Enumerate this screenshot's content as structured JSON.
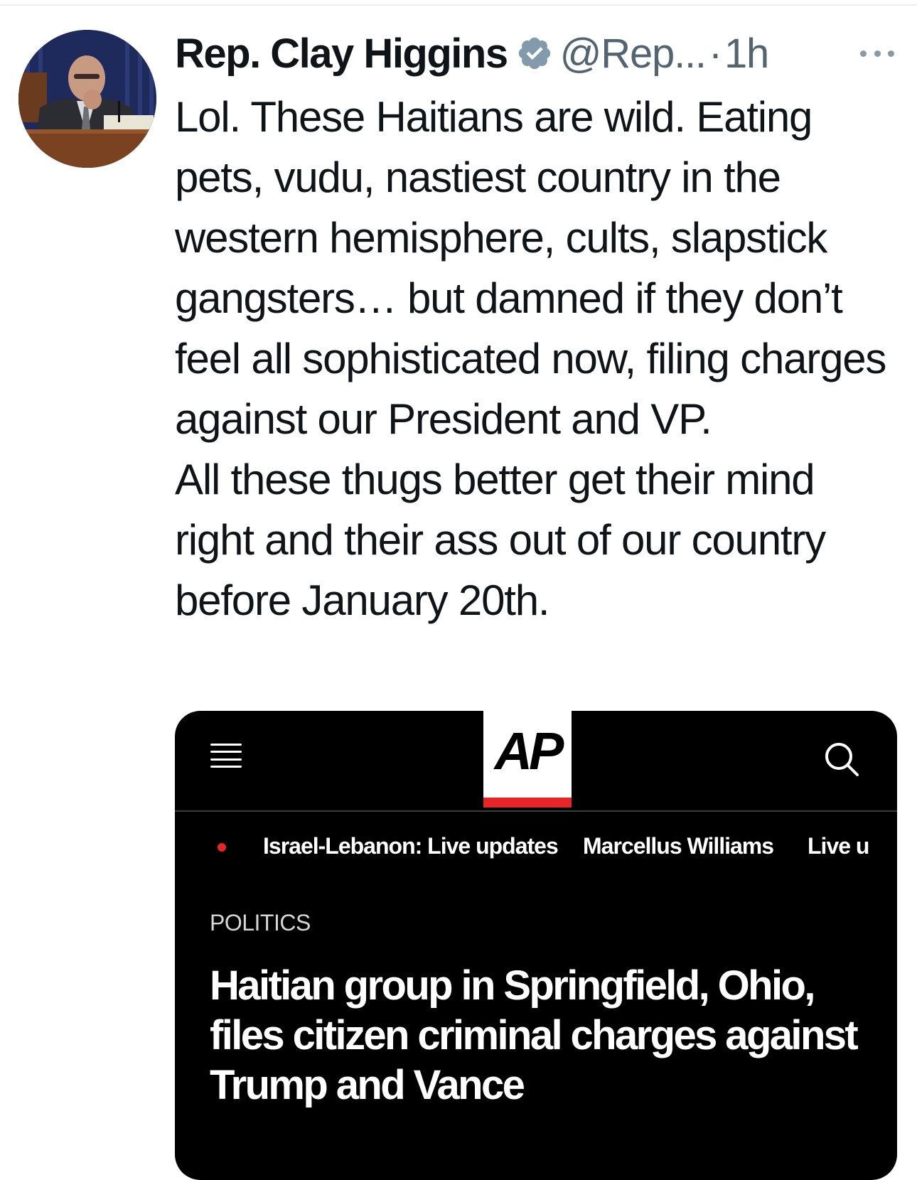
{
  "tweet": {
    "author": {
      "display_name": "Rep. Clay Higgins",
      "handle": "@Rep...",
      "verified": true,
      "avatar_icon": "profile-photo"
    },
    "separator": "·",
    "timestamp": "1h",
    "more_icon": "ellipsis-icon",
    "text": "Lol. These Haitians are wild. Eating pets, vudu, nastiest country in the western hemisphere, cults, slapstick gangsters… but damned if they don’t feel all sophisticated now, filing charges against our President and VP.\n  All these thugs better get their mind right and their ass out of our country before January 20th."
  },
  "card": {
    "menu_icon": "hamburger-menu-icon",
    "logo": "AP",
    "search_icon": "search-icon",
    "ticker": [
      "Israel-Lebanon: Live updates",
      "Marcellus Williams",
      "Live u"
    ],
    "section": "POLITICS",
    "headline": "Haitian group in Springfield, Ohio, files citizen criminal charges against Trump and Vance"
  },
  "colors": {
    "verified_badge": "#829aab",
    "secondary_text": "#536471",
    "ap_red": "#e8262a",
    "card_background": "#000000"
  }
}
